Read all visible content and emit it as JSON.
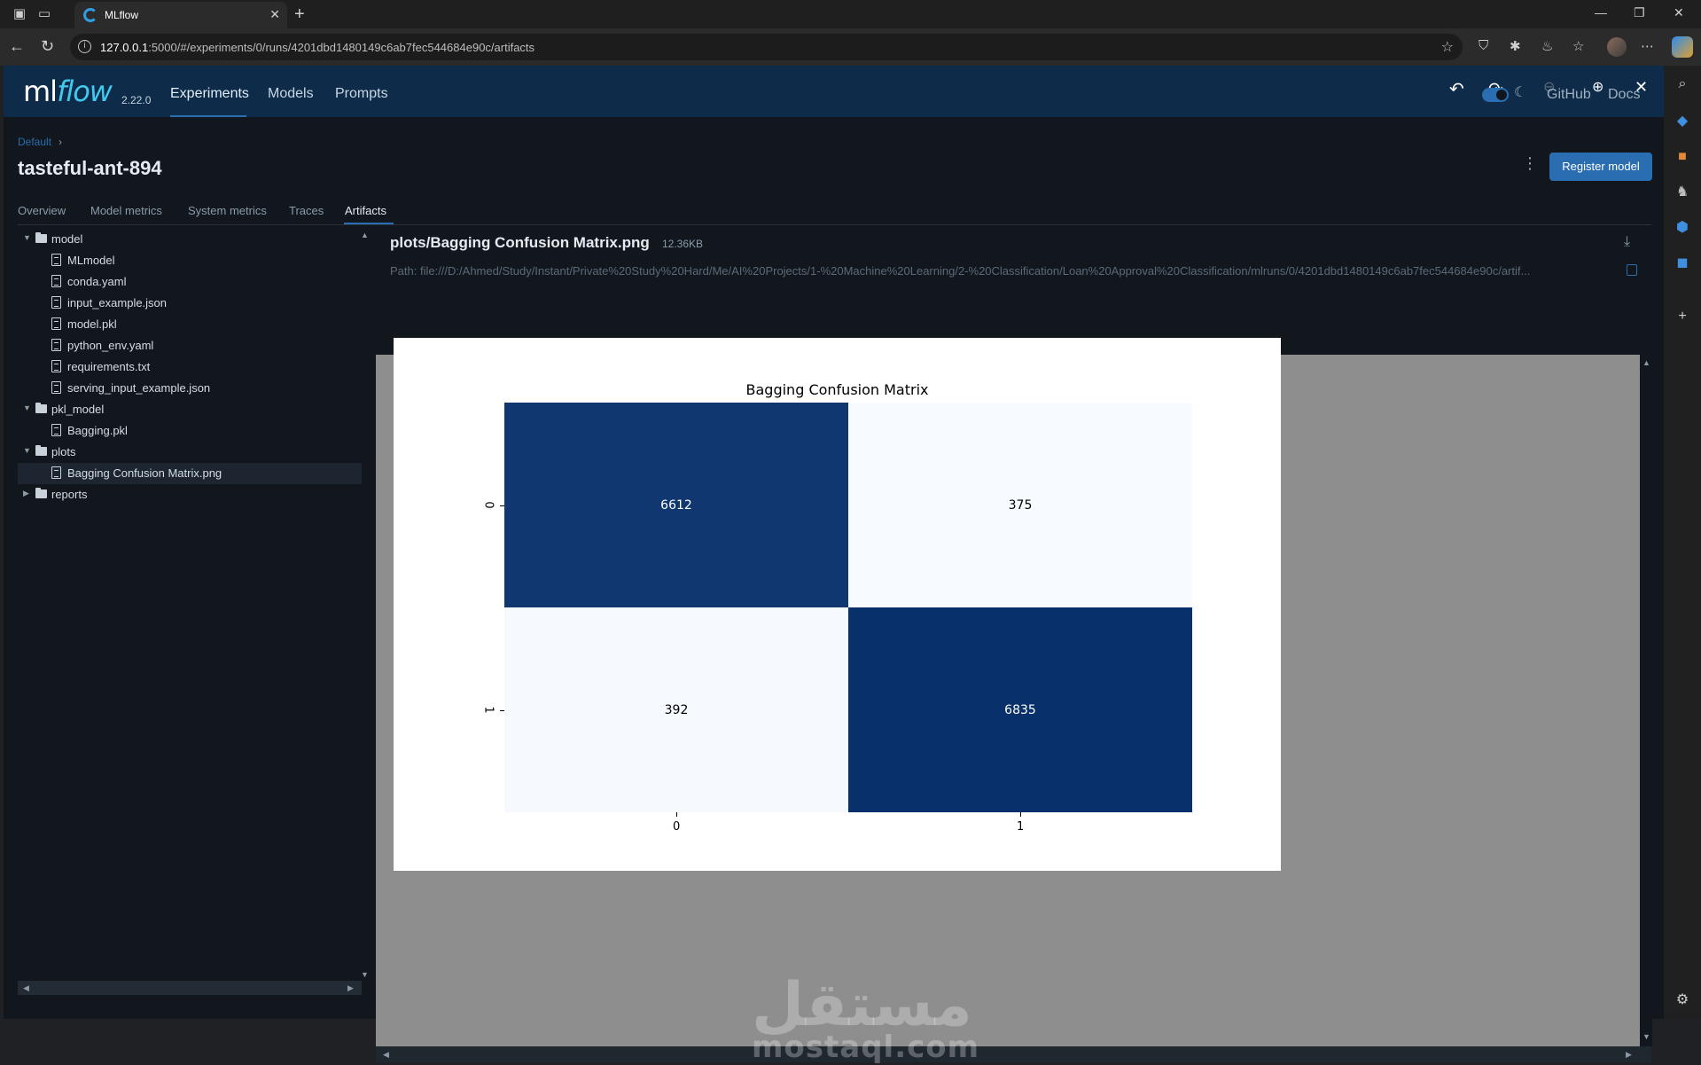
{
  "browser": {
    "tab_title": "MLflow",
    "url_host": "127.0.0.1",
    "url_rest": ":5000/#/experiments/0/runs/4201dbd1480149c6ab7fec544684e90c/artifacts"
  },
  "app": {
    "logo_ml": "ml",
    "logo_flow": "flow",
    "version": "2.22.0",
    "nav": [
      "Experiments",
      "Models",
      "Prompts"
    ],
    "active_nav": "Experiments",
    "links": [
      "GitHub",
      "Docs"
    ]
  },
  "run": {
    "breadcrumb": "Default",
    "breadcrumb_sep": "›",
    "title": "tasteful-ant-894",
    "register_label": "Register model",
    "tabs": [
      "Overview",
      "Model metrics",
      "System metrics",
      "Traces",
      "Artifacts"
    ],
    "active_tab": "Artifacts"
  },
  "tree": [
    {
      "label": "model",
      "type": "folder",
      "level": 0,
      "expanded": true
    },
    {
      "label": "MLmodel",
      "type": "file",
      "level": 1
    },
    {
      "label": "conda.yaml",
      "type": "file",
      "level": 1
    },
    {
      "label": "input_example.json",
      "type": "file",
      "level": 1
    },
    {
      "label": "model.pkl",
      "type": "file",
      "level": 1
    },
    {
      "label": "python_env.yaml",
      "type": "file",
      "level": 1
    },
    {
      "label": "requirements.txt",
      "type": "file",
      "level": 1
    },
    {
      "label": "serving_input_example.json",
      "type": "file",
      "level": 1
    },
    {
      "label": "pkl_model",
      "type": "folder",
      "level": 0,
      "expanded": true
    },
    {
      "label": "Bagging.pkl",
      "type": "file",
      "level": 1
    },
    {
      "label": "plots",
      "type": "folder",
      "level": 0,
      "expanded": true
    },
    {
      "label": "Bagging Confusion Matrix.png",
      "type": "file",
      "level": 1,
      "selected": true
    },
    {
      "label": "reports",
      "type": "folder",
      "level": 0,
      "expanded": false
    }
  ],
  "artifact": {
    "name": "plots/Bagging Confusion Matrix.png",
    "size": "12.36KB",
    "path": "Path: file:///D:/Ahmed/Study/Instant/Private%20Study%20Hard/Me/AI%20Projects/1-%20Machine%20Learning/2-%20Classification/Loan%20Approval%20Classification/mlruns/0/4201dbd1480149c6ab7fec544684e90c/artif..."
  },
  "chart_data": {
    "type": "heatmap",
    "title": "Bagging Confusion Matrix",
    "row_labels": [
      "0",
      "1"
    ],
    "col_labels": [
      "0",
      "1"
    ],
    "values": [
      [
        6612,
        375
      ],
      [
        392,
        6835
      ]
    ],
    "colormap": {
      "low": "#f7fbff",
      "high": "#08306b"
    }
  },
  "watermark": {
    "arabic": "مستقل",
    "latin": "mostaql.com"
  },
  "colors": {
    "accent": "#2a6db0",
    "header_bg": "#0e2c4a",
    "app_bg": "#11171c"
  }
}
